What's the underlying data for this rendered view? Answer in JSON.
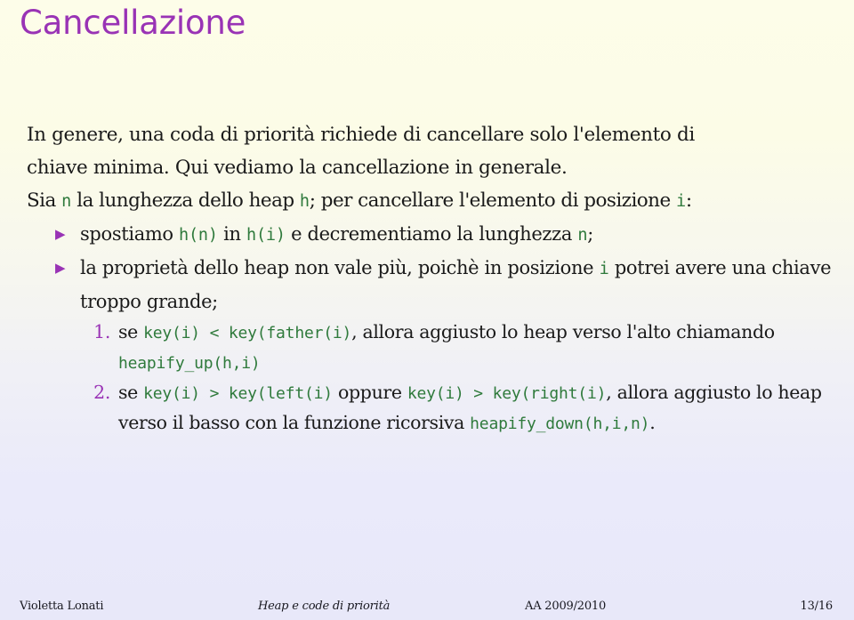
{
  "slide": {
    "title": "Cancellazione",
    "page_number": "13/16"
  },
  "colors": {
    "title_purple": "#9933b5",
    "code_green": "#2f7a3c",
    "body_text": "#1a1a1a",
    "bg_top": "#fdfde9",
    "bg_bottom": "#e8e8f9"
  },
  "body": {
    "intro": {
      "line1": "In genere, una coda di priorità richiede di cancellare solo l'elemento di",
      "line2": "chiave minima. Qui vediamo la cancellazione in generale."
    },
    "lead": {
      "t1": "Sia ",
      "c1": "n",
      "t2": " la lunghezza dello heap ",
      "c2": "h",
      "t3": "; per cancellare l'elemento di posizione ",
      "c3": "i",
      "t4": ":"
    },
    "bullets": [
      {
        "marker": "▶",
        "t1": "spostiamo ",
        "c1": "h(n)",
        "t2": " in ",
        "c2": "h(i)",
        "t3": " e decrementiamo la lunghezza ",
        "c3": "n",
        "t4": ";"
      },
      {
        "marker": "▶",
        "t1": "la proprietà dello heap non vale più, poichè in posizione ",
        "c1": "i",
        "t2": " potrei avere una chiave troppo grande;",
        "c2": "",
        "t3": "",
        "c3": "",
        "t4": ""
      }
    ],
    "enumerated": [
      {
        "num": "1.",
        "t1": "se ",
        "c1": "key(i) < key(father(i)",
        "t2": ", allora aggiusto lo heap verso l'alto chiamando ",
        "c2": "heapify_up(h,i)",
        "t3": "",
        "c3": "",
        "t4": ""
      },
      {
        "num": "2.",
        "t1": "se ",
        "c1": "key(i) > key(left(i)",
        "t2": " oppure ",
        "c2": "key(i) > key(right(i)",
        "t3": ", allora aggiusto lo heap verso il basso con la funzione ricorsiva ",
        "c3": "heapify_down(h,i,n)",
        "t4": "."
      }
    ]
  },
  "footer": {
    "author": "Violetta Lonati",
    "subject": "Heap e code di priorità",
    "year": "AA 2009/2010",
    "page": "13/16"
  }
}
